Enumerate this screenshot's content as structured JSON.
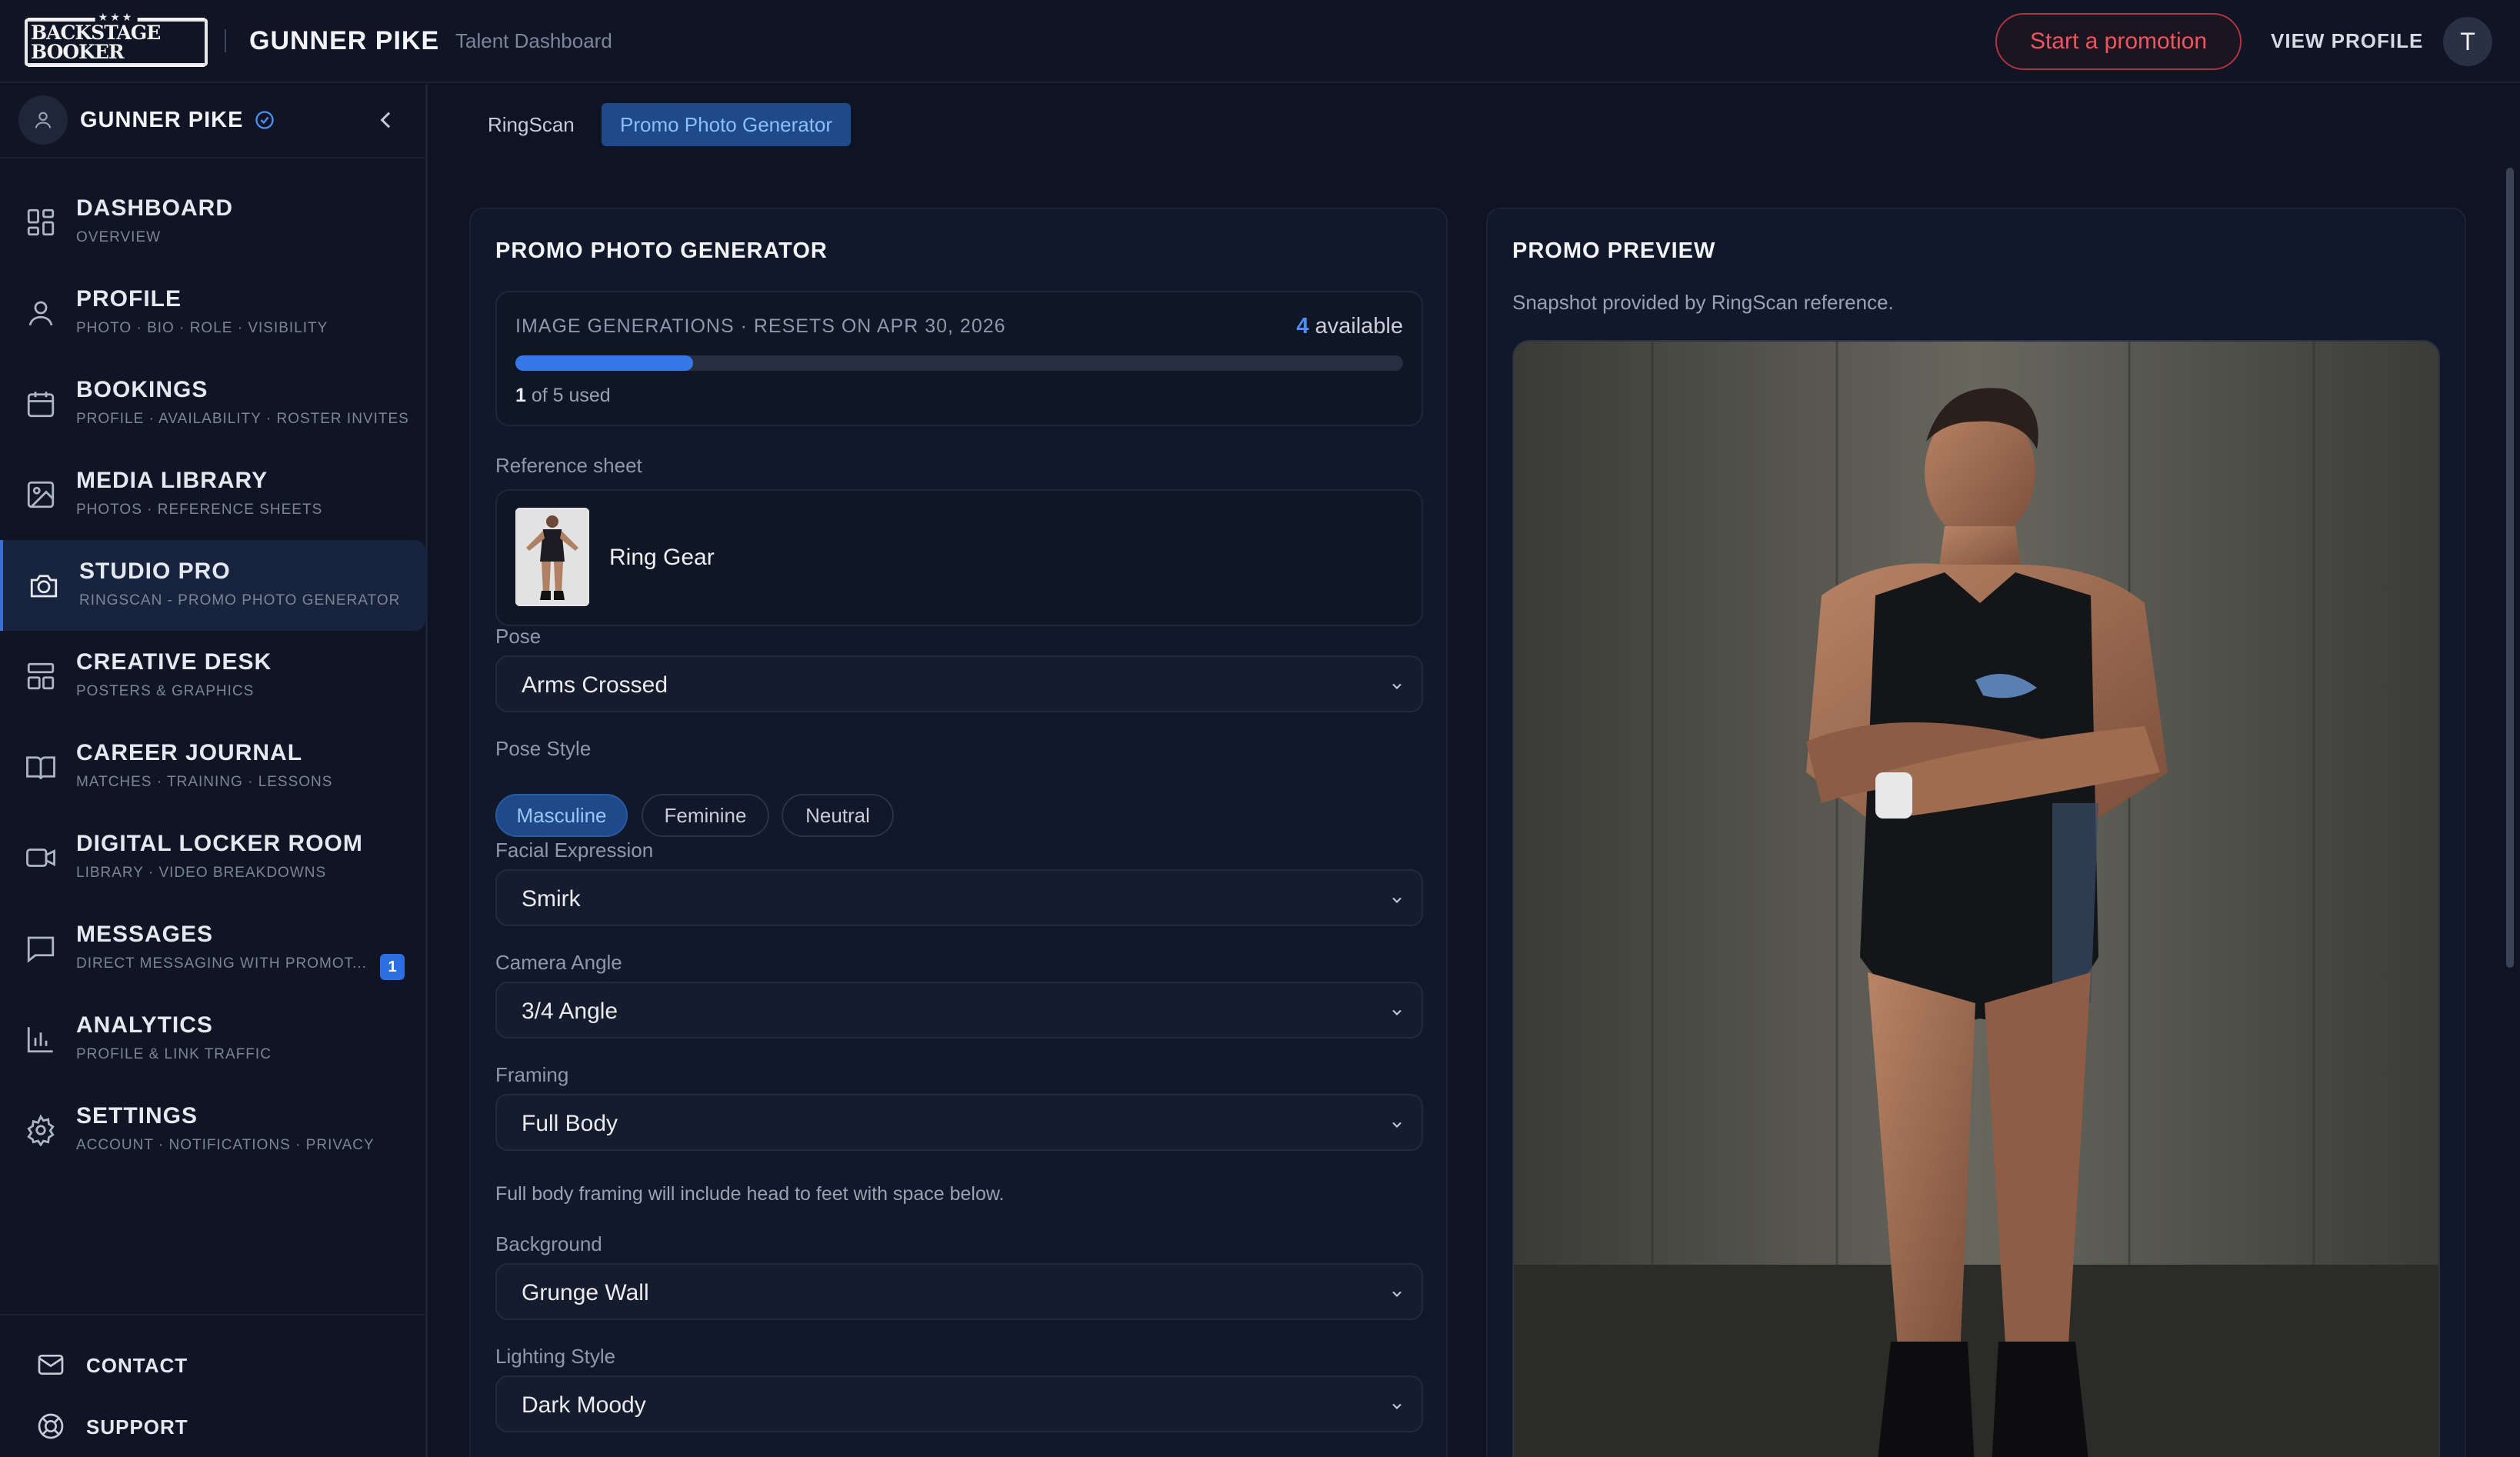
{
  "app": {
    "logo_text": "BACKSTAGE BOOKER",
    "talent_name": "GUNNER PIKE",
    "subtitle": "Talent Dashboard",
    "promo_button": "Start a promotion",
    "view_profile": "VIEW PROFILE",
    "avatar_initial": "T"
  },
  "sidebar": {
    "name": "GUNNER PIKE",
    "items": [
      {
        "title": "DASHBOARD",
        "sub": "OVERVIEW",
        "icon": "grid-icon"
      },
      {
        "title": "PROFILE",
        "sub": "PHOTO · BIO · ROLE · VISIBILITY",
        "icon": "user-icon"
      },
      {
        "title": "BOOKINGS",
        "sub": "PROFILE · AVAILABILITY · ROSTER INVITES",
        "icon": "calendar-icon"
      },
      {
        "title": "MEDIA LIBRARY",
        "sub": "PHOTOS · REFERENCE SHEETS",
        "icon": "image-icon"
      },
      {
        "title": "STUDIO PRO",
        "sub": "RINGSCAN - PROMO PHOTO GENERATOR",
        "icon": "camera-icon"
      },
      {
        "title": "CREATIVE DESK",
        "sub": "POSTERS & GRAPHICS",
        "icon": "layout-icon"
      },
      {
        "title": "CAREER JOURNAL",
        "sub": "MATCHES · TRAINING · LESSONS",
        "icon": "book-icon"
      },
      {
        "title": "DIGITAL LOCKER ROOM",
        "sub": "LIBRARY · VIDEO BREAKDOWNS",
        "icon": "video-icon"
      },
      {
        "title": "MESSAGES",
        "sub": "DIRECT MESSAGING WITH PROMOT...",
        "icon": "chat-icon",
        "badge": "1"
      },
      {
        "title": "ANALYTICS",
        "sub": "PROFILE & LINK TRAFFIC",
        "icon": "bar-chart-icon"
      },
      {
        "title": "SETTINGS",
        "sub": "ACCOUNT · NOTIFICATIONS · PRIVACY",
        "icon": "gear-icon"
      }
    ],
    "active_index": 4,
    "footer": [
      {
        "label": "CONTACT",
        "icon": "mail-icon"
      },
      {
        "label": "SUPPORT",
        "icon": "lifebuoy-icon"
      }
    ]
  },
  "tabs": [
    {
      "label": "RingScan"
    },
    {
      "label": "Promo Photo Generator"
    }
  ],
  "generator": {
    "title": "PROMO PHOTO GENERATOR",
    "quota_label": "IMAGE GENERATIONS · RESETS ON APR 30, 2026",
    "available_count": "4",
    "available_word": "available",
    "used_count": "1",
    "used_rest": "of 5 used",
    "used_fraction": 0.2,
    "reference_label": "Reference sheet",
    "reference_name": "Ring Gear",
    "pose_label": "Pose",
    "pose_value": "Arms Crossed",
    "pose_style_label": "Pose Style",
    "pose_styles": [
      "Masculine",
      "Feminine",
      "Neutral"
    ],
    "expression_label": "Facial Expression",
    "expression_value": "Smirk",
    "camera_label": "Camera Angle",
    "camera_value": "3/4 Angle",
    "framing_label": "Framing",
    "framing_value": "Full Body",
    "framing_hint": "Full body framing will include head to feet with space below.",
    "background_label": "Background",
    "background_value": "Grunge Wall",
    "lighting_label": "Lighting Style",
    "lighting_value": "Dark Moody"
  },
  "preview": {
    "title": "PROMO PREVIEW",
    "subtitle": "Snapshot provided by RingScan reference."
  },
  "colors": {
    "accent": "#3576e8",
    "promo_red": "#f0555f",
    "background": "#0e1423"
  }
}
